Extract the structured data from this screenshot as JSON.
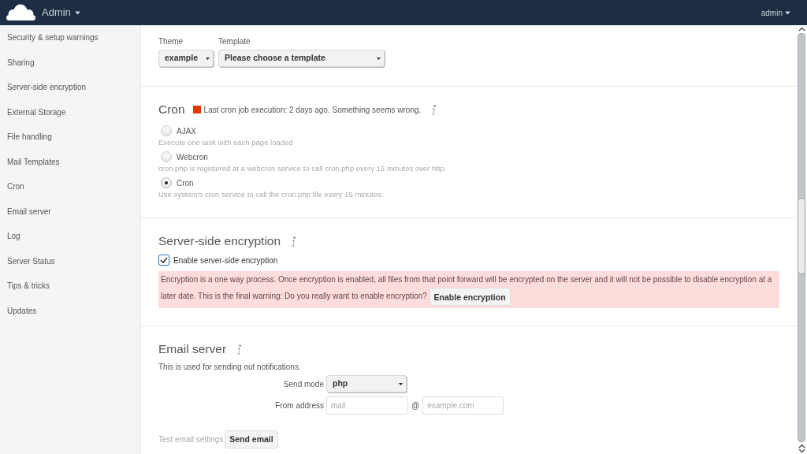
{
  "header": {
    "app_menu": "Admin",
    "user_menu": "admin"
  },
  "sidebar": {
    "items": [
      {
        "label": "Security & setup warnings"
      },
      {
        "label": "Sharing"
      },
      {
        "label": "Server-side encryption"
      },
      {
        "label": "External Storage"
      },
      {
        "label": "File handling"
      },
      {
        "label": "Mail Templates"
      },
      {
        "label": "Cron"
      },
      {
        "label": "Email server"
      },
      {
        "label": "Log"
      },
      {
        "label": "Server Status"
      },
      {
        "label": "Tips & tricks"
      },
      {
        "label": "Updates"
      }
    ]
  },
  "sections": [
    {
      "kind": "mail_templates",
      "selects": [
        {
          "label": "Theme",
          "value": "example"
        },
        {
          "label": "Template",
          "value": "Please choose a template"
        }
      ]
    },
    {
      "kind": "cron",
      "title": "Cron",
      "status": "Last cron job execution: 2 days ago. Something seems wrong.",
      "options": [
        {
          "label": "AJAX",
          "description": "Execute one task with each page loaded",
          "selected": false
        },
        {
          "label": "Webcron",
          "description": "cron.php is registered at a webcron service to call cron.php every 15 minutes over http.",
          "selected": false
        },
        {
          "label": "Cron",
          "description": "Use system's cron service to call the cron.php file every 15 minutes.",
          "selected": true
        }
      ]
    },
    {
      "kind": "encryption",
      "title": "Server-side encryption",
      "checkbox": {
        "label": "Enable server-side encryption",
        "checked": true
      },
      "warning": {
        "text": "Encryption is a one way process. Once encryption is enabled, all files from that point forward will be encrypted on the server and it will not be possible to disable encryption at a later date. This is the final warning: Do you really want to enable encryption?",
        "button": "Enable encryption"
      }
    },
    {
      "kind": "email",
      "title": "Email server",
      "description": "This is used for sending out notifications.",
      "send_mode": {
        "label": "Send mode",
        "value": "php"
      },
      "from_address": {
        "label": "From address",
        "user_placeholder": "mail",
        "separator": "@",
        "domain_placeholder": "example.com"
      },
      "test": {
        "label": "Test email settings",
        "button": "Send email"
      }
    }
  ]
}
